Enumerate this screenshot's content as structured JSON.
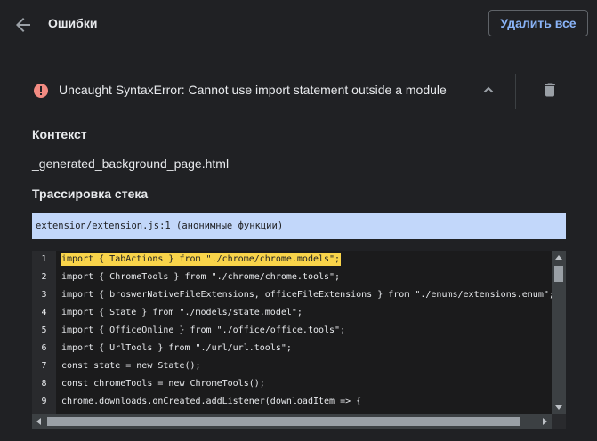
{
  "header": {
    "title": "Ошибки",
    "remove_all_label": "Удалить все"
  },
  "error": {
    "message": "Uncaught SyntaxError: Cannot use import statement outside a module",
    "icon": "error-circle-icon",
    "icon_color": "#f28b82",
    "expanded": true
  },
  "context": {
    "heading": "Контекст",
    "value": "_generated_background_page.html"
  },
  "stack_trace": {
    "heading": "Трассировка стека",
    "frames": [
      "extension/extension.js:1 (анонимные функции)"
    ]
  },
  "code": {
    "highlight_line": 1,
    "lines": [
      {
        "num": "1",
        "text": "import { TabActions } from \"./chrome/chrome.models\";"
      },
      {
        "num": "2",
        "text": "import { ChromeTools } from \"./chrome/chrome.tools\";"
      },
      {
        "num": "3",
        "text": "import { broswerNativeFileExtensions, officeFileExtensions } from \"./enums/extensions.enum\";"
      },
      {
        "num": "4",
        "text": "import { State } from \"./models/state.model\";"
      },
      {
        "num": "5",
        "text": "import { OfficeOnline } from \"./office/office.tools\";"
      },
      {
        "num": "6",
        "text": "import { UrlTools } from \"./url/url.tools\";"
      },
      {
        "num": "7",
        "text": "const state = new State();"
      },
      {
        "num": "8",
        "text": "const chromeTools = new ChromeTools();"
      },
      {
        "num": "9",
        "text": "chrome.downloads.onCreated.addListener(downloadItem => {"
      }
    ]
  },
  "colors": {
    "background": "#202124",
    "accent": "#8ab4f8",
    "trace_highlight": "#c2d7fa",
    "code_highlight": "#f9d44a"
  }
}
